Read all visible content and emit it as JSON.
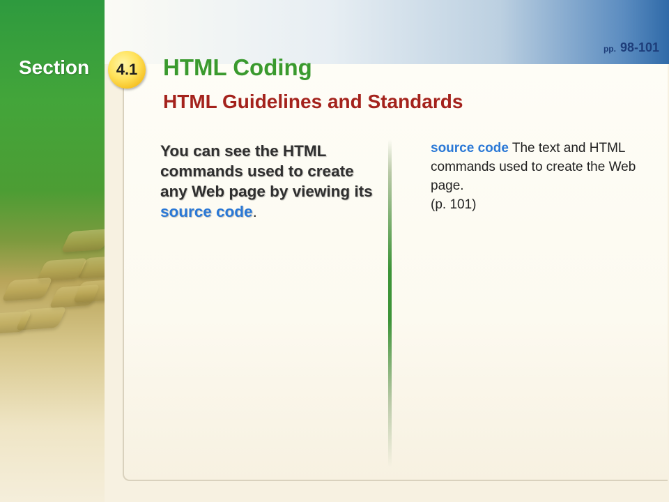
{
  "section": {
    "label": "Section",
    "number": "4.1"
  },
  "header": {
    "title": "HTML Coding",
    "subtitle": "HTML Guidelines and Standards",
    "page_prefix": "pp.",
    "page_range": "98-101"
  },
  "left_column": {
    "text_before": "You can see the HTML commands used to create any Web page by viewing its ",
    "term": "source code",
    "text_after": "."
  },
  "right_column": {
    "term": "source code",
    "definition": " The text and HTML commands used to create the Web page.",
    "page_note": "(p. 101)"
  },
  "colors": {
    "title_green": "#3a9a2e",
    "subtitle_red": "#a4221c",
    "term_blue": "#2a78d6",
    "badge_yellow": "#ffe25a"
  }
}
